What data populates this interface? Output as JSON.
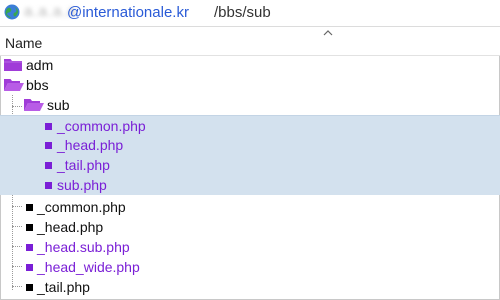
{
  "address": {
    "host_redacted": "a.a.a.a",
    "host_visible": "@internationale.kr",
    "path": "/bbs/sub"
  },
  "columns": {
    "name": "Name"
  },
  "tree": {
    "adm": "adm",
    "bbs": "bbs",
    "sub": "sub",
    "sub_common": "_common.php",
    "sub_head": "_head.php",
    "sub_tail": "_tail.php",
    "sub_sub": "sub.php",
    "bbs_common": "_common.php",
    "bbs_head": "_head.php",
    "bbs_head_sub": "_head.sub.php",
    "bbs_head_wide": "_head_wide.php",
    "bbs_tail": "_tail.php"
  },
  "colors": {
    "folder": "#a03cd8",
    "php_modified": "#7a1fd6",
    "selection": "#d3e1ee",
    "host_link": "#2a5bd7"
  }
}
